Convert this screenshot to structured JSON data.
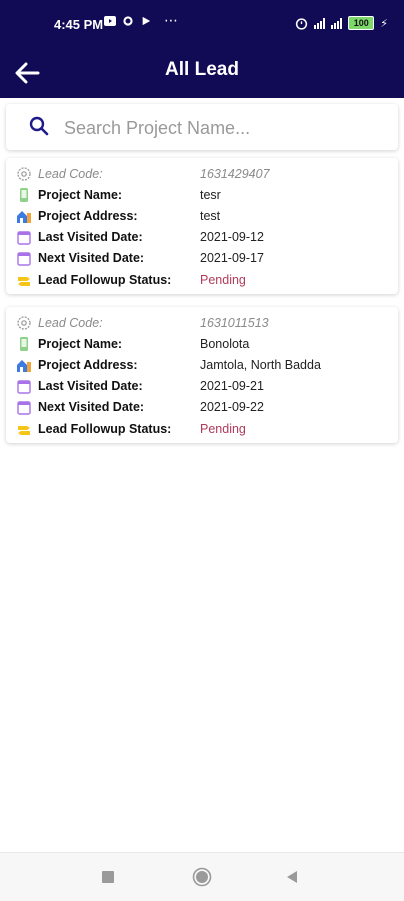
{
  "status_bar": {
    "time": "4:45 PM",
    "dots": "⋯",
    "battery": "100",
    "network": "4G"
  },
  "header": {
    "title": "All Lead"
  },
  "search": {
    "placeholder": "Search Project Name..."
  },
  "leads": [
    {
      "code_label": "Lead Code:",
      "code": "1631429407",
      "name_label": "Project Name:",
      "name": "tesr",
      "address_label": "Project Address:",
      "address": "test",
      "last_label": "Last Visited Date:",
      "last": "2021-09-12",
      "next_label": "Next Visited Date:",
      "next": "2021-09-17",
      "status_label": "Lead Followup Status:",
      "status": "Pending"
    },
    {
      "code_label": "Lead Code:",
      "code": "1631011513",
      "name_label": "Project Name:",
      "name": "Bonolota",
      "address_label": "Project Address:",
      "address": "Jamtola, North Badda",
      "last_label": "Last Visited Date:",
      "last": "2021-09-21",
      "next_label": "Next Visited Date:",
      "next": "2021-09-22",
      "status_label": "Lead Followup Status:",
      "status": "Pending"
    }
  ],
  "colors": {
    "header_bg": "#110a55",
    "pending": "#b03a5b",
    "search_icon": "#1e1a8a"
  }
}
